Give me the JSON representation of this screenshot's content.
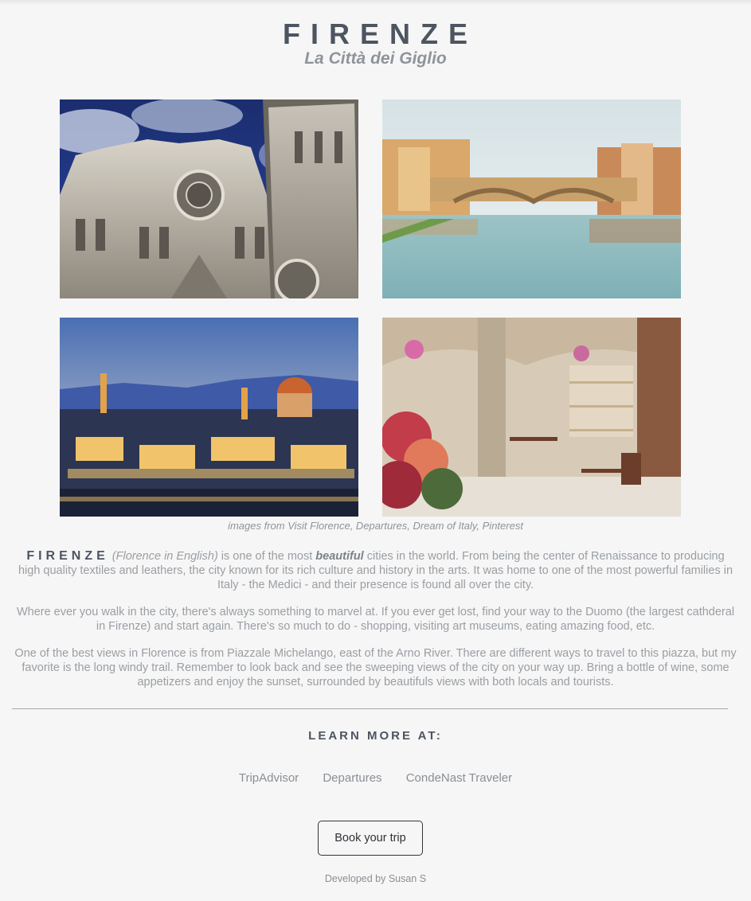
{
  "header": {
    "title": "FIRENZE",
    "subtitle": "La Città dei Giglio"
  },
  "photos": [
    {
      "name": "duomo-facade"
    },
    {
      "name": "ponte-vecchio"
    },
    {
      "name": "city-skyline-dusk"
    },
    {
      "name": "cafe-interior-flowers"
    }
  ],
  "credit": "images from Visit Florence, Departures, Dream of Italy, Pinterest",
  "intro": {
    "keyword": "FIRENZE",
    "paren": "(Florence in English)",
    "text_a": " is one of the most ",
    "beautiful": "beautiful",
    "text_b": " cities in the world. From being the center of Renaissance to producing high quality textiles and leathers, the city known for its rich culture and history in the arts. It was home to one of the most powerful families in Italy - the Medici - and their presence is found all over the city."
  },
  "paragraph2": "Where ever you walk in the city, there's always something to marvel at. If you ever get lost, find your way to the Duomo (the largest cathderal in Firenze) and start again. There's so much to do - shopping, visiting art museums, eating amazing food, etc.",
  "paragraph3": "One of the best views in Florence is from Piazzale Michelango, east of the Arno River. There are different ways to travel to this piazza, but my favorite is the long windy trail. Remember to look back and see the sweeping views of the city on your way up. Bring a bottle of wine, some appetizers and enjoy the sunset, surrounded by beautifuls views with both locals and tourists.",
  "learn_more": "LEARN MORE AT:",
  "links": [
    "TripAdvisor",
    "Departures",
    "CondeNast Traveler"
  ],
  "book_button": "Book your trip",
  "footer": "Developed by Susan S"
}
